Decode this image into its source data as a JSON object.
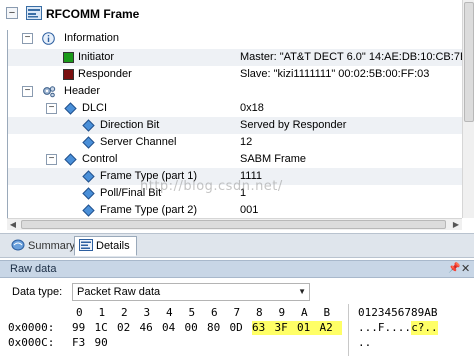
{
  "frame_title": "RFCOMM Frame",
  "tree": {
    "information_label": "Information",
    "initiator": {
      "label": "Initiator",
      "value": "Master: \"AT&T DECT 6.0\" 14:AE:DB:10:CB:7E",
      "color": "#1a9a1a"
    },
    "responder": {
      "label": "Responder",
      "value": "Slave: \"kizi1111111\" 00:02:5B:00:FF:03",
      "color": "#7a1010"
    },
    "header_label": "Header",
    "dlci": {
      "label": "DLCI",
      "value": "0x18"
    },
    "direction_bit": {
      "label": "Direction Bit",
      "value": "Served by Responder"
    },
    "server_channel": {
      "label": "Server Channel",
      "value": "12"
    },
    "control": {
      "label": "Control",
      "value": "SABM Frame"
    },
    "frame_type_1": {
      "label": "Frame Type (part 1)",
      "value": "1111"
    },
    "poll_final_bit": {
      "label": "Poll/Final Bit",
      "value": "1"
    },
    "frame_type_2": {
      "label": "Frame Type (part 2)",
      "value": "001"
    }
  },
  "watermark": "http://blog.csdn.net/",
  "tabs": {
    "summary": "Summary",
    "details": "Details"
  },
  "raw_data": {
    "title": "Raw data",
    "data_type_label": "Data type:",
    "data_type_value": "Packet Raw data",
    "column_headers": [
      "0",
      "1",
      "2",
      "3",
      "4",
      "5",
      "6",
      "7",
      "8",
      "9",
      "A",
      "B"
    ],
    "ascii_header": "0123456789AB",
    "rows": [
      {
        "offset": "0x0000:",
        "bytes": [
          "99",
          "1C",
          "02",
          "46",
          "04",
          "00",
          "80",
          "0D",
          "63",
          "3F",
          "01",
          "A2"
        ],
        "ascii_plain": "...F....",
        "ascii_hl": "c?.."
      },
      {
        "offset": "0x000C:",
        "bytes": [
          "F3",
          "90"
        ],
        "ascii_plain": "..",
        "ascii_hl": ""
      }
    ],
    "highlight_color": "#ffff66"
  }
}
